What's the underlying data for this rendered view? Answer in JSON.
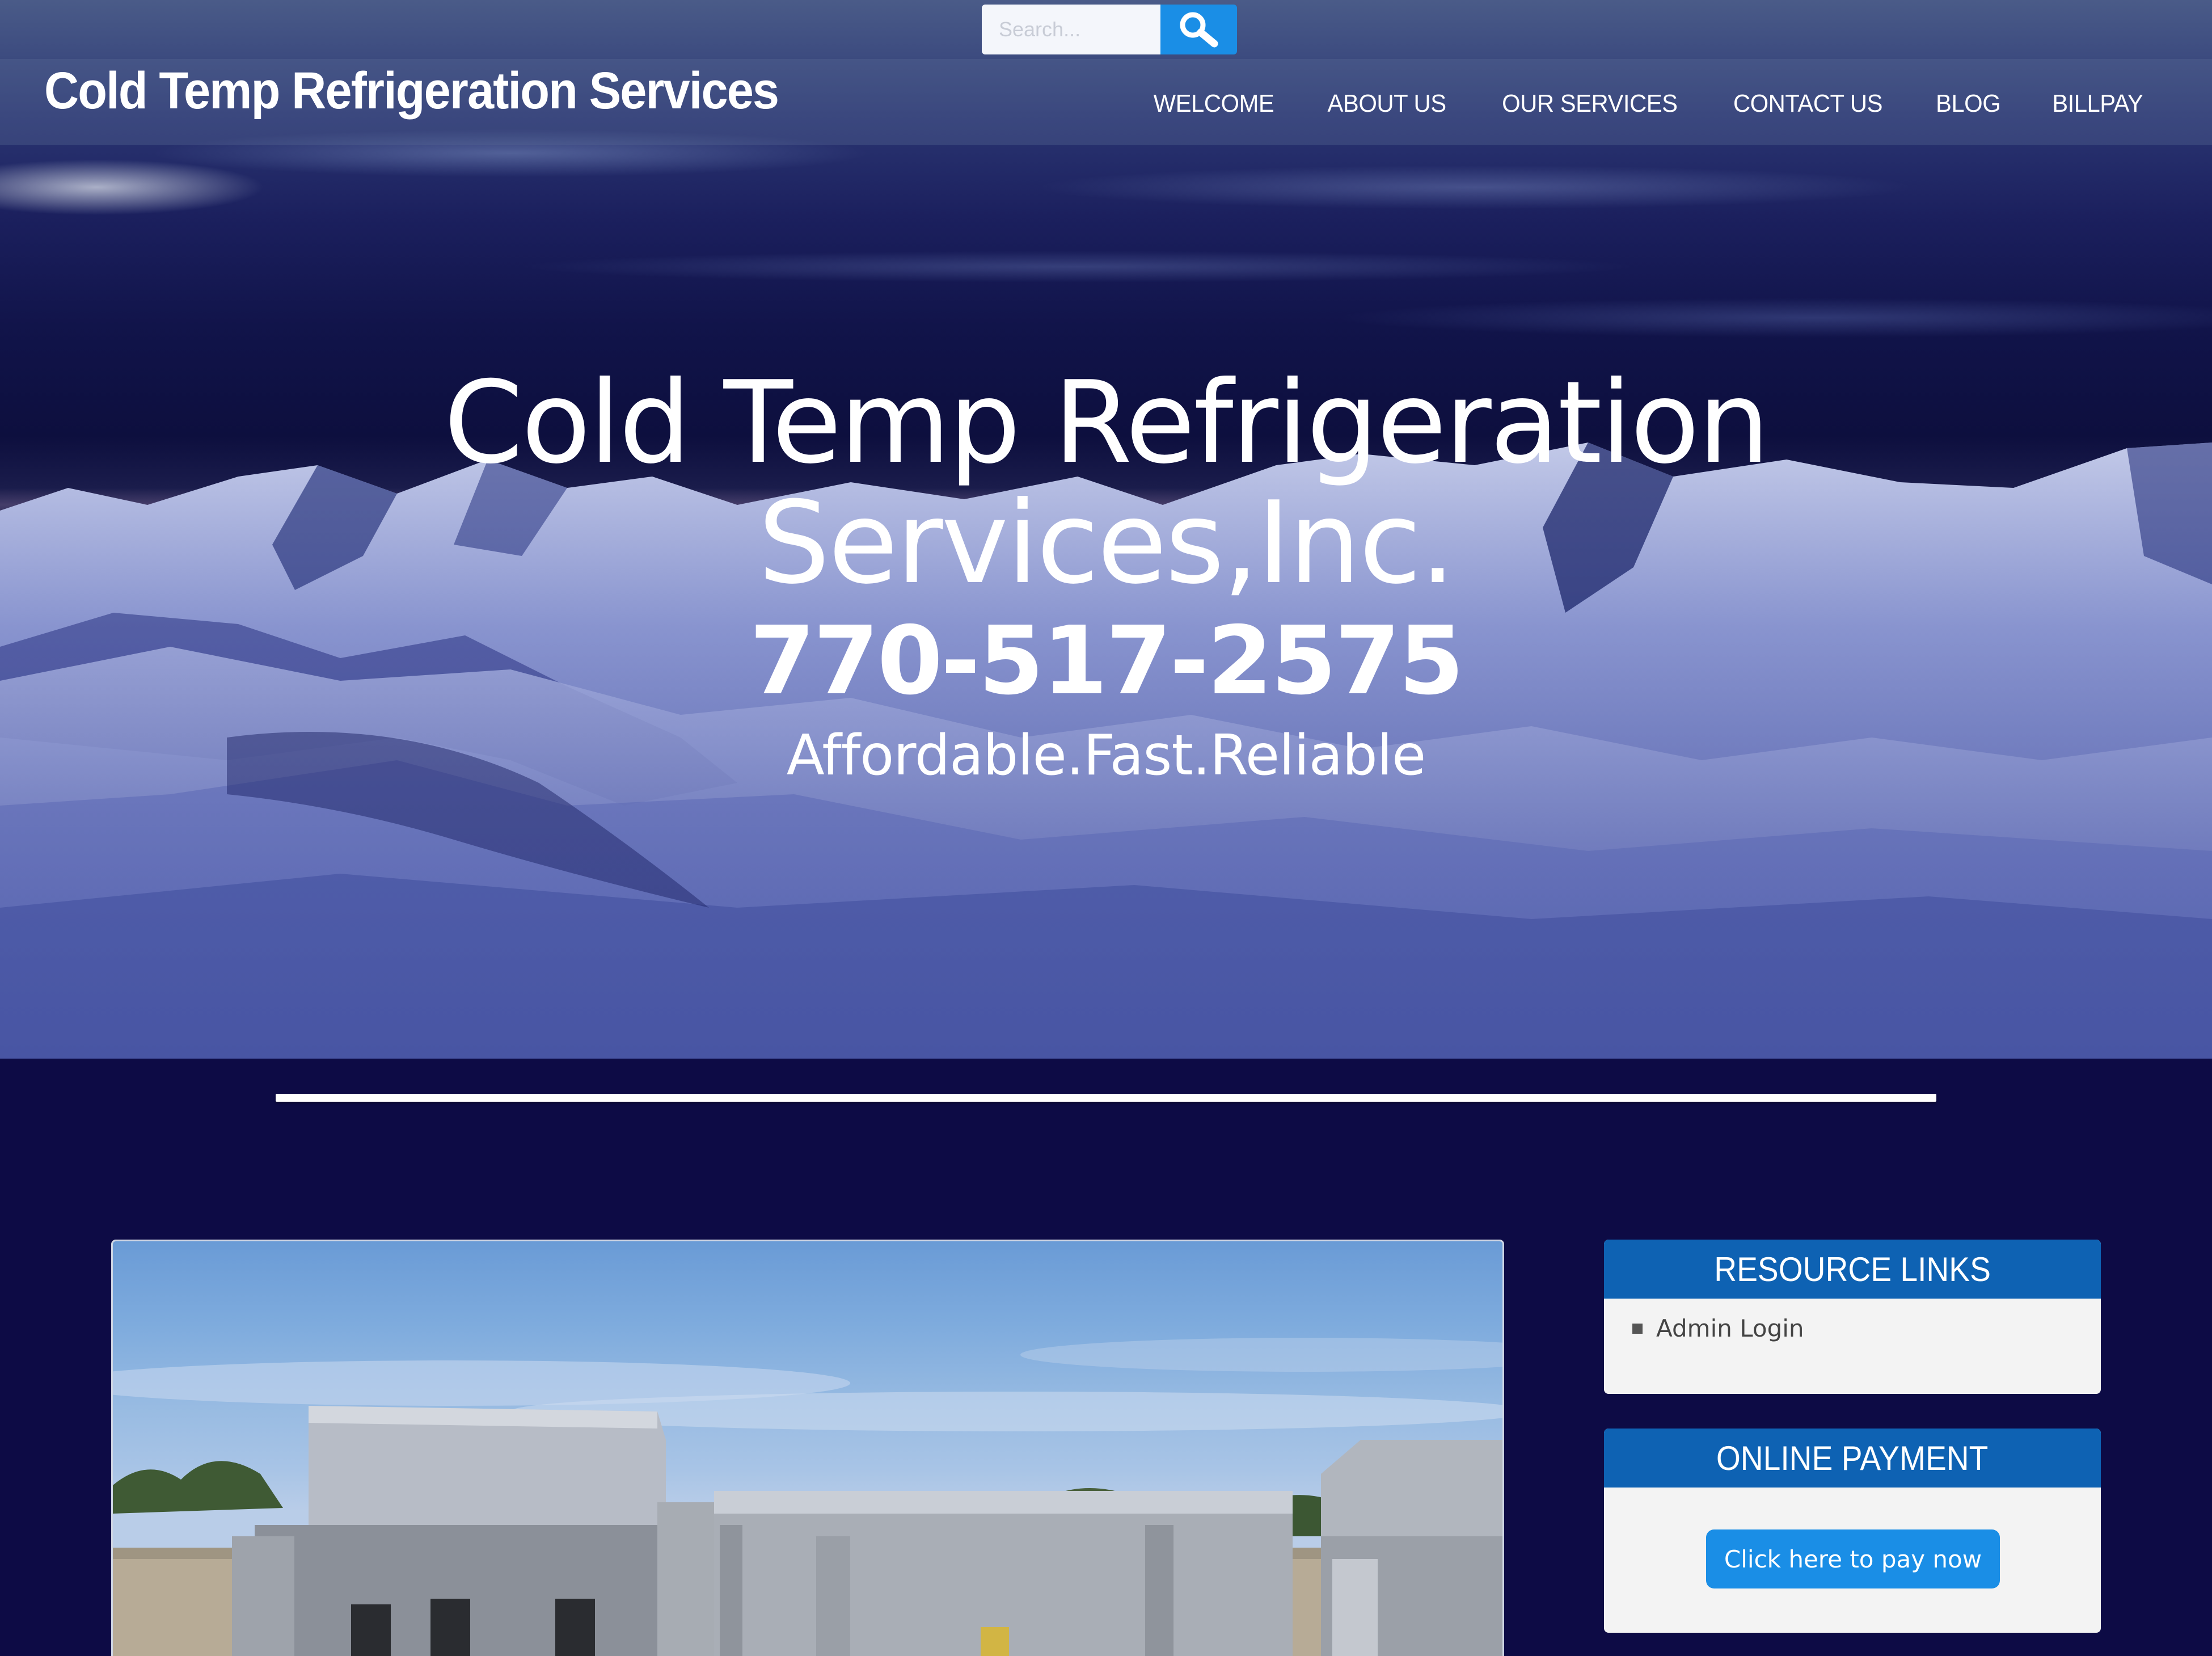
{
  "search": {
    "placeholder": "Search..."
  },
  "header": {
    "site_title": "Cold Temp Refrigeration Services"
  },
  "nav": {
    "items": [
      {
        "label": "WELCOME"
      },
      {
        "label": "ABOUT US"
      },
      {
        "label": "OUR SERVICES"
      },
      {
        "label": "CONTACT US"
      },
      {
        "label": "BLOG"
      },
      {
        "label": "BILLPAY"
      }
    ]
  },
  "hero": {
    "title_line1": "Cold Temp Refrigeration",
    "title_line2": "Services,Inc.",
    "phone": "770-517-2575",
    "tagline": "Affordable.Fast.Reliable"
  },
  "sidebar": {
    "resource_links": {
      "heading": "RESOURCE LINKS",
      "items": [
        {
          "label": "Admin Login"
        }
      ]
    },
    "online_payment": {
      "heading": "ONLINE PAYMENT",
      "button_label": "Click here to pay now"
    }
  },
  "colors": {
    "page_background": "#0d0b45",
    "accent_blue": "#1a8ee6",
    "widget_header": "#0e62b3"
  },
  "icons": {
    "search_button": "search-icon"
  }
}
